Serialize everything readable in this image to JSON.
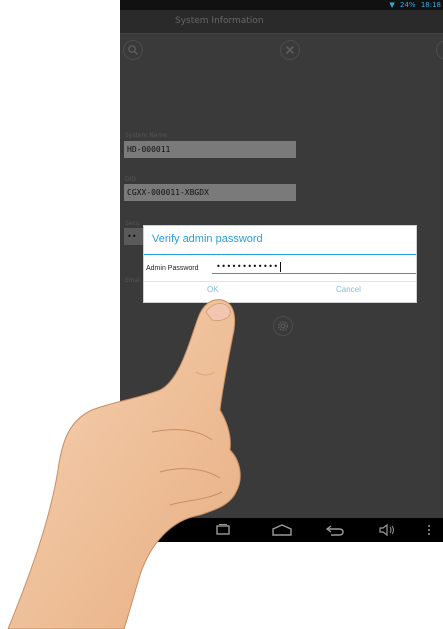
{
  "status_bar": {
    "battery": "24%",
    "time": "18:18"
  },
  "title_bar": {
    "title": "System Information"
  },
  "fields": {
    "system_name": {
      "label": "System Name",
      "value": "HD-000011"
    },
    "did": {
      "label": "DID",
      "value": "CGXX-000011-XBGDX"
    },
    "security_code": {
      "label": "Secu",
      "value": "••"
    },
    "email": {
      "label": "Emai"
    }
  },
  "dialog": {
    "title": "Verify admin password",
    "field_label": "Admin Password",
    "field_value": "••••••••••••",
    "ok_label": "OK",
    "cancel_label": "Cancel"
  },
  "colors": {
    "accent": "#2aa0d8",
    "screen_bg": "#3a3a3a",
    "button_text": "#7bbedf"
  },
  "icons": [
    "search-icon",
    "close-icon",
    "settings-icon",
    "recent-apps-icon",
    "home-icon",
    "back-icon",
    "volume-icon",
    "menu-icon"
  ]
}
